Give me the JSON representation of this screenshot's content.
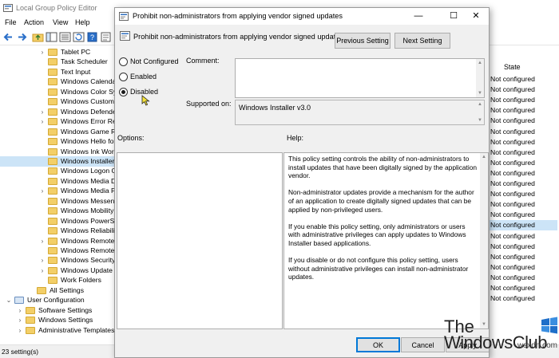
{
  "editor": {
    "title": "Local Group Policy Editor",
    "menu": [
      "File",
      "Action",
      "View",
      "Help"
    ],
    "tree_items": [
      {
        "label": "Tablet PC",
        "indent": 3,
        "expander": true
      },
      {
        "label": "Task Scheduler",
        "indent": 3,
        "expander": false
      },
      {
        "label": "Text Input",
        "indent": 3,
        "expander": false
      },
      {
        "label": "Windows Calendar",
        "indent": 3,
        "expander": false
      },
      {
        "label": "Windows Color System",
        "indent": 3,
        "expander": false
      },
      {
        "label": "Windows Customer",
        "indent": 3,
        "expander": false
      },
      {
        "label": "Windows Defender",
        "indent": 3,
        "expander": true
      },
      {
        "label": "Windows Error Reporting",
        "indent": 3,
        "expander": true
      },
      {
        "label": "Windows Game Recording",
        "indent": 3,
        "expander": false
      },
      {
        "label": "Windows Hello for Business",
        "indent": 3,
        "expander": false
      },
      {
        "label": "Windows Ink Workspace",
        "indent": 3,
        "expander": false
      },
      {
        "label": "Windows Installer",
        "indent": 3,
        "expander": false,
        "selected": true
      },
      {
        "label": "Windows Logon Options",
        "indent": 3,
        "expander": false
      },
      {
        "label": "Windows Media Digital",
        "indent": 3,
        "expander": false
      },
      {
        "label": "Windows Media Player",
        "indent": 3,
        "expander": true
      },
      {
        "label": "Windows Messenger",
        "indent": 3,
        "expander": false
      },
      {
        "label": "Windows Mobility Center",
        "indent": 3,
        "expander": false
      },
      {
        "label": "Windows PowerShell",
        "indent": 3,
        "expander": false
      },
      {
        "label": "Windows Reliability",
        "indent": 3,
        "expander": false
      },
      {
        "label": "Windows Remote Management",
        "indent": 3,
        "expander": true
      },
      {
        "label": "Windows Remote Shell",
        "indent": 3,
        "expander": false
      },
      {
        "label": "Windows Security",
        "indent": 3,
        "expander": true
      },
      {
        "label": "Windows Update",
        "indent": 3,
        "expander": true
      },
      {
        "label": "Work Folders",
        "indent": 3,
        "expander": false
      },
      {
        "label": "All Settings",
        "indent": 2,
        "expander": false
      },
      {
        "label": "User Configuration",
        "indent": 0,
        "expander": true
      },
      {
        "label": "Software Settings",
        "indent": 1,
        "expander": true
      },
      {
        "label": "Windows Settings",
        "indent": 1,
        "expander": true
      },
      {
        "label": "Administrative Templates",
        "indent": 1,
        "expander": true
      }
    ],
    "state_header": "State",
    "state_value": "Not configured",
    "state_rows": 22,
    "state_selected_index": 14,
    "status": "23 setting(s)"
  },
  "dialog": {
    "title": "Prohibit non-administrators from applying vendor signed updates",
    "header": "Prohibit non-administrators from applying vendor signed updates",
    "controls": {
      "minimize": "—",
      "maximize": "☐",
      "close": "✕"
    },
    "prev_button": "Previous Setting",
    "next_button": "Next Setting",
    "radios": [
      {
        "label": "Not Configured",
        "checked": false
      },
      {
        "label": "Enabled",
        "checked": false
      },
      {
        "label": "Disabled",
        "checked": true
      }
    ],
    "comment_label": "Comment:",
    "supported_label": "Supported on:",
    "supported_value": "Windows Installer v3.0",
    "options_label": "Options:",
    "help_label": "Help:",
    "help_paragraphs": [
      "This policy setting controls the ability of non-administrators to install updates that have been digitally signed by the application vendor.",
      "Non-administrator updates provide a mechanism for the author of an application to create digitally signed updates that can be applied by non-privileged users.",
      "If you enable this policy setting, only administrators or users with administrative privileges can apply updates to Windows Installer based applications.",
      "If you disable or do not configure this policy setting, users without administrative privileges can install non-administrator updates."
    ],
    "ok_button": "OK",
    "cancel_button": "Cancel",
    "apply_button": "Apply"
  },
  "watermark": {
    "line1": "The",
    "line2": "WindowsClub",
    "domain": "wsxdn.com"
  },
  "colors": {
    "selection": "#cce4f7",
    "accent": "#0078d7",
    "folder": "#f3cf68"
  }
}
